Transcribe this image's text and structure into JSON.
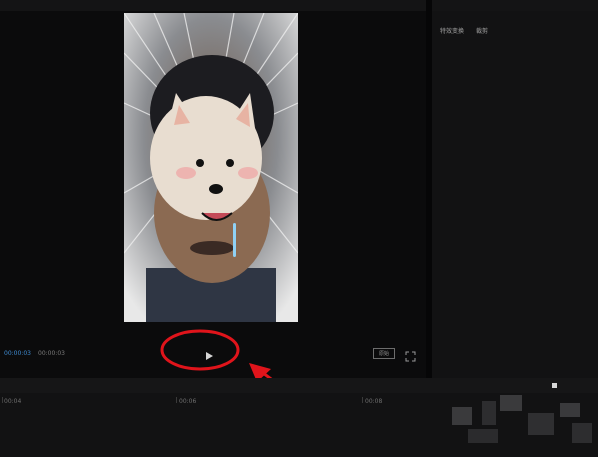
{
  "side_panel": {
    "tabs": [
      "特效变换",
      "裁剪"
    ]
  },
  "player": {
    "time_current": "00:00:03",
    "time_total": "00:00:03",
    "aspect_label": "原始",
    "icons": {
      "play": "play-icon",
      "fullscreen": "fullscreen-icon"
    }
  },
  "timeline": {
    "ruler_labels": [
      "00:04",
      "00:06",
      "00:08"
    ]
  },
  "annotation": {
    "color": "#e0141b"
  },
  "colors": {
    "accent_time": "#3f8bd1"
  }
}
